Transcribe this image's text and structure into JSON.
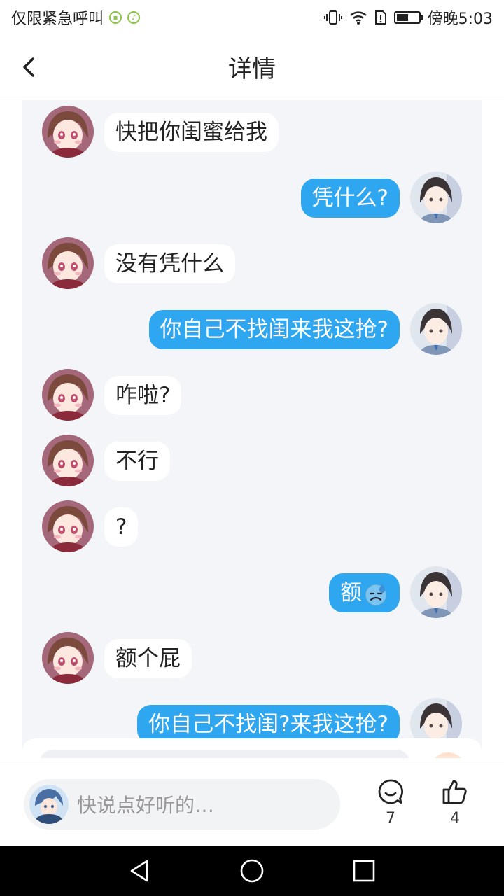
{
  "status_bar": {
    "carrier_text": "仅限紧急呼叫",
    "time_text": "傍晚5:03",
    "battery_level": 0.55
  },
  "header": {
    "title": "详情",
    "back_icon": "chevron-left-icon"
  },
  "messages": [
    {
      "side": "left",
      "text": "快把你闺蜜给我"
    },
    {
      "side": "right",
      "text": "凭什么?"
    },
    {
      "side": "left",
      "text": "没有凭什么"
    },
    {
      "side": "right",
      "text": "你自己不找闺来我这抢?"
    },
    {
      "side": "left",
      "text": "咋啦?"
    },
    {
      "side": "left",
      "text": "不行"
    },
    {
      "side": "left",
      "text": "?"
    },
    {
      "side": "right",
      "text": "额",
      "emoji": "sweat-frown-emoji"
    },
    {
      "side": "left",
      "text": "额个屁"
    },
    {
      "side": "right",
      "text": "你自己不找闺?来我这抢?"
    }
  ],
  "comment_bar": {
    "placeholder": "快说点好听的…",
    "comment_count": "7",
    "like_count": "4"
  },
  "colors": {
    "bubble_blue": "#2ea7f0",
    "panel_bg": "#f3f5f8"
  }
}
